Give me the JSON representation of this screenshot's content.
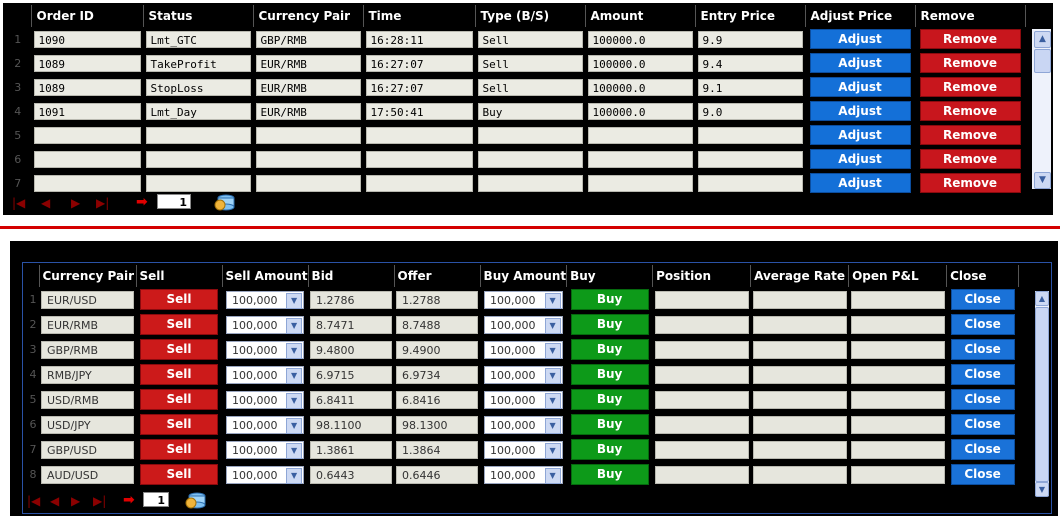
{
  "orders": {
    "columns": [
      "Order ID",
      "Status",
      "Currency Pair",
      "Time",
      "Type (B/S)",
      "Amount",
      "Entry Price",
      "Adjust Price",
      "Remove"
    ],
    "rows": [
      {
        "num": "1",
        "order_id": "1090",
        "status": "Lmt_GTC",
        "pair": "GBP/RMB",
        "time": "16:28:11",
        "type": "Sell",
        "amount": "100000.0",
        "price": "9.9"
      },
      {
        "num": "2",
        "order_id": "1089",
        "status": "TakeProfit",
        "pair": "EUR/RMB",
        "time": "16:27:07",
        "type": "Sell",
        "amount": "100000.0",
        "price": "9.4"
      },
      {
        "num": "3",
        "order_id": "1089",
        "status": "StopLoss",
        "pair": "EUR/RMB",
        "time": "16:27:07",
        "type": "Sell",
        "amount": "100000.0",
        "price": "9.1"
      },
      {
        "num": "4",
        "order_id": "1091",
        "status": "Lmt_Day",
        "pair": "EUR/RMB",
        "time": "17:50:41",
        "type": "Buy",
        "amount": "100000.0",
        "price": "9.0"
      },
      {
        "num": "5",
        "order_id": "",
        "status": "",
        "pair": "",
        "time": "",
        "type": "",
        "amount": "",
        "price": ""
      },
      {
        "num": "6",
        "order_id": "",
        "status": "",
        "pair": "",
        "time": "",
        "type": "",
        "amount": "",
        "price": ""
      },
      {
        "num": "7",
        "order_id": "",
        "status": "",
        "pair": "",
        "time": "",
        "type": "",
        "amount": "",
        "price": ""
      }
    ],
    "adjust_label": "Adjust",
    "remove_label": "Remove",
    "page": "1"
  },
  "rates": {
    "columns": [
      "Currency Pair",
      "Sell",
      "Sell Amount",
      "Bid",
      "Offer",
      "Buy Amount",
      "Buy",
      "Position",
      "Average Rate",
      "Open P&L",
      "Close"
    ],
    "rows": [
      {
        "num": "1",
        "pair": "EUR/USD",
        "sell_amount": "100,000",
        "bid": "1.2786",
        "offer": "1.2788",
        "buy_amount": "100,000"
      },
      {
        "num": "2",
        "pair": "EUR/RMB",
        "sell_amount": "100,000",
        "bid": "8.7471",
        "offer": "8.7488",
        "buy_amount": "100,000"
      },
      {
        "num": "3",
        "pair": "GBP/RMB",
        "sell_amount": "100,000",
        "bid": "9.4800",
        "offer": "9.4900",
        "buy_amount": "100,000"
      },
      {
        "num": "4",
        "pair": "RMB/JPY",
        "sell_amount": "100,000",
        "bid": "6.9715",
        "offer": "6.9734",
        "buy_amount": "100,000"
      },
      {
        "num": "5",
        "pair": "USD/RMB",
        "sell_amount": "100,000",
        "bid": "6.8411",
        "offer": "6.8416",
        "buy_amount": "100,000"
      },
      {
        "num": "6",
        "pair": "USD/JPY",
        "sell_amount": "100,000",
        "bid": "98.1100",
        "offer": "98.1300",
        "buy_amount": "100,000"
      },
      {
        "num": "7",
        "pair": "GBP/USD",
        "sell_amount": "100,000",
        "bid": "1.3861",
        "offer": "1.3864",
        "buy_amount": "100,000"
      },
      {
        "num": "8",
        "pair": "AUD/USD",
        "sell_amount": "100,000",
        "bid": "0.6443",
        "offer": "0.6446",
        "buy_amount": "100,000"
      }
    ],
    "sell_label": "Sell",
    "buy_label": "Buy",
    "close_label": "Close",
    "page": "1"
  },
  "colors": {
    "adjust": "#1470d8",
    "remove": "#c8161d",
    "sell": "#cc1a1a",
    "buy": "#0d9a19",
    "close": "#1a72d8",
    "divider": "#d40000"
  }
}
